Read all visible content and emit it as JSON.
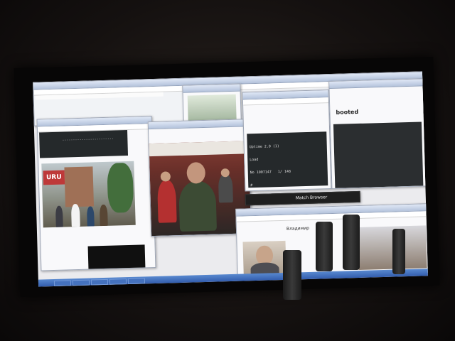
{
  "scene": "photo of a monitor showing many overlapping windows",
  "windows": {
    "back_browser": {
      "tabs": [
        "",
        "",
        ""
      ]
    },
    "terminal_center": {
      "lines": [
        "Uptime 2.0 (1)",
        "Load",
        "No 1007147   1/ 148",
        "#"
      ]
    },
    "terminal_right": {
      "title": "booted",
      "lines": [
        "",
        "",
        "",
        ""
      ]
    },
    "match_browser": {
      "title": "Match Browser"
    },
    "webcam": {
      "name": "Владимир"
    },
    "stream": {
      "overlay": "URU"
    }
  },
  "colors": {
    "taskbar": "#2b5cb8",
    "terminal": "#24282b",
    "titlebar": "#aebfdc"
  }
}
